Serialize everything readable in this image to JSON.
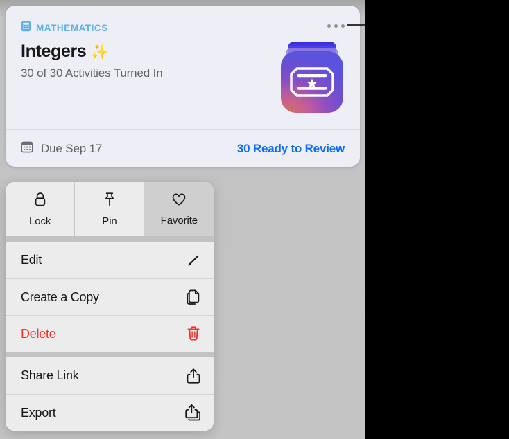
{
  "window": {
    "background_color": "#c4c4c4",
    "void_color": "#000000"
  },
  "assignment_card": {
    "subject": {
      "icon": "calculator-icon",
      "label": "MATHEMATICS",
      "color": "#59b0ea"
    },
    "title": "Integers",
    "title_emoji": "✨",
    "subtitle": "30 of 30 Activities Turned In",
    "more_button": {
      "icon": "ellipsis-icon",
      "label": "More"
    },
    "app_icon": {
      "name": "activity-app-icon",
      "glyph": "ticket-with-star",
      "gradient_from": "#5b52dd",
      "gradient_to": "#d8705e"
    },
    "footer": {
      "due_icon": "calendar-icon",
      "due_text": "Due Sep 17",
      "review_link": "30 Ready to Review",
      "review_link_color": "#0a6cf5"
    }
  },
  "context_menu": {
    "quick_actions": [
      {
        "label": "Lock",
        "icon": "lock-icon",
        "active": false
      },
      {
        "label": "Pin",
        "icon": "pin-icon",
        "active": false
      },
      {
        "label": "Favorite",
        "icon": "heart-icon",
        "active": true
      }
    ],
    "groups": [
      {
        "items": [
          {
            "label": "Edit",
            "icon": "pencil-icon",
            "destructive": false
          },
          {
            "label": "Create a Copy",
            "icon": "duplicate-icon",
            "destructive": false
          },
          {
            "label": "Delete",
            "icon": "trash-icon",
            "destructive": true
          }
        ]
      },
      {
        "items": [
          {
            "label": "Share Link",
            "icon": "share-icon",
            "destructive": false
          },
          {
            "label": "Export",
            "icon": "export-icon",
            "destructive": false
          }
        ]
      }
    ]
  },
  "annotation": {
    "callout_line_color": "#333338"
  }
}
